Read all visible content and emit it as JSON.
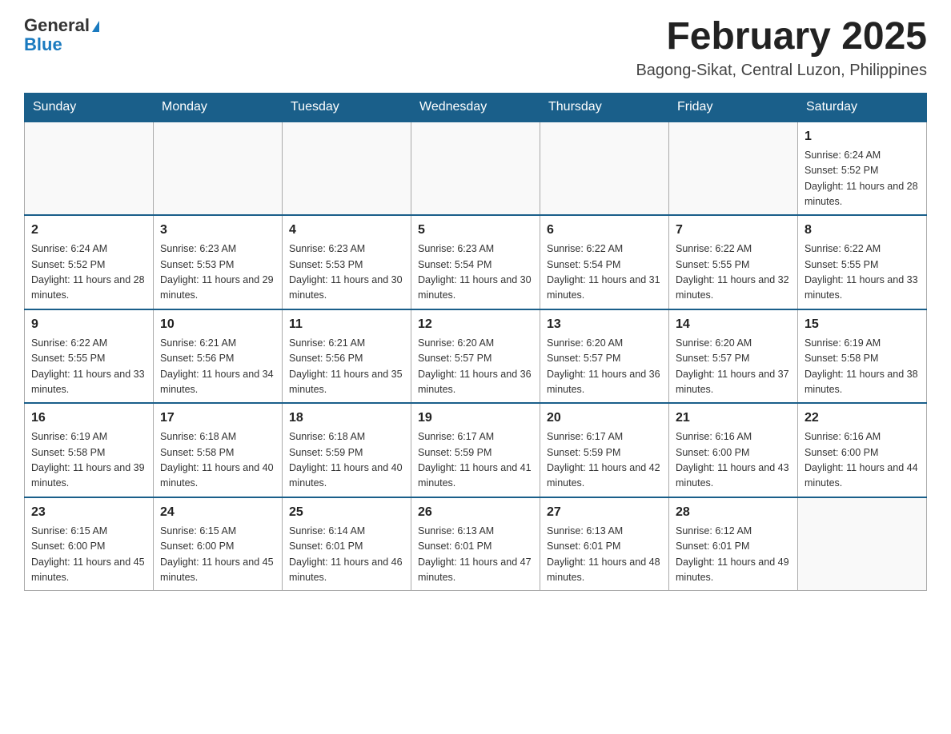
{
  "header": {
    "logo_general": "General",
    "logo_blue": "Blue",
    "title": "February 2025",
    "subtitle": "Bagong-Sikat, Central Luzon, Philippines"
  },
  "days_of_week": [
    "Sunday",
    "Monday",
    "Tuesday",
    "Wednesday",
    "Thursday",
    "Friday",
    "Saturday"
  ],
  "weeks": [
    [
      {
        "day": "",
        "sunrise": "",
        "sunset": "",
        "daylight": ""
      },
      {
        "day": "",
        "sunrise": "",
        "sunset": "",
        "daylight": ""
      },
      {
        "day": "",
        "sunrise": "",
        "sunset": "",
        "daylight": ""
      },
      {
        "day": "",
        "sunrise": "",
        "sunset": "",
        "daylight": ""
      },
      {
        "day": "",
        "sunrise": "",
        "sunset": "",
        "daylight": ""
      },
      {
        "day": "",
        "sunrise": "",
        "sunset": "",
        "daylight": ""
      },
      {
        "day": "1",
        "sunrise": "Sunrise: 6:24 AM",
        "sunset": "Sunset: 5:52 PM",
        "daylight": "Daylight: 11 hours and 28 minutes."
      }
    ],
    [
      {
        "day": "2",
        "sunrise": "Sunrise: 6:24 AM",
        "sunset": "Sunset: 5:52 PM",
        "daylight": "Daylight: 11 hours and 28 minutes."
      },
      {
        "day": "3",
        "sunrise": "Sunrise: 6:23 AM",
        "sunset": "Sunset: 5:53 PM",
        "daylight": "Daylight: 11 hours and 29 minutes."
      },
      {
        "day": "4",
        "sunrise": "Sunrise: 6:23 AM",
        "sunset": "Sunset: 5:53 PM",
        "daylight": "Daylight: 11 hours and 30 minutes."
      },
      {
        "day": "5",
        "sunrise": "Sunrise: 6:23 AM",
        "sunset": "Sunset: 5:54 PM",
        "daylight": "Daylight: 11 hours and 30 minutes."
      },
      {
        "day": "6",
        "sunrise": "Sunrise: 6:22 AM",
        "sunset": "Sunset: 5:54 PM",
        "daylight": "Daylight: 11 hours and 31 minutes."
      },
      {
        "day": "7",
        "sunrise": "Sunrise: 6:22 AM",
        "sunset": "Sunset: 5:55 PM",
        "daylight": "Daylight: 11 hours and 32 minutes."
      },
      {
        "day": "8",
        "sunrise": "Sunrise: 6:22 AM",
        "sunset": "Sunset: 5:55 PM",
        "daylight": "Daylight: 11 hours and 33 minutes."
      }
    ],
    [
      {
        "day": "9",
        "sunrise": "Sunrise: 6:22 AM",
        "sunset": "Sunset: 5:55 PM",
        "daylight": "Daylight: 11 hours and 33 minutes."
      },
      {
        "day": "10",
        "sunrise": "Sunrise: 6:21 AM",
        "sunset": "Sunset: 5:56 PM",
        "daylight": "Daylight: 11 hours and 34 minutes."
      },
      {
        "day": "11",
        "sunrise": "Sunrise: 6:21 AM",
        "sunset": "Sunset: 5:56 PM",
        "daylight": "Daylight: 11 hours and 35 minutes."
      },
      {
        "day": "12",
        "sunrise": "Sunrise: 6:20 AM",
        "sunset": "Sunset: 5:57 PM",
        "daylight": "Daylight: 11 hours and 36 minutes."
      },
      {
        "day": "13",
        "sunrise": "Sunrise: 6:20 AM",
        "sunset": "Sunset: 5:57 PM",
        "daylight": "Daylight: 11 hours and 36 minutes."
      },
      {
        "day": "14",
        "sunrise": "Sunrise: 6:20 AM",
        "sunset": "Sunset: 5:57 PM",
        "daylight": "Daylight: 11 hours and 37 minutes."
      },
      {
        "day": "15",
        "sunrise": "Sunrise: 6:19 AM",
        "sunset": "Sunset: 5:58 PM",
        "daylight": "Daylight: 11 hours and 38 minutes."
      }
    ],
    [
      {
        "day": "16",
        "sunrise": "Sunrise: 6:19 AM",
        "sunset": "Sunset: 5:58 PM",
        "daylight": "Daylight: 11 hours and 39 minutes."
      },
      {
        "day": "17",
        "sunrise": "Sunrise: 6:18 AM",
        "sunset": "Sunset: 5:58 PM",
        "daylight": "Daylight: 11 hours and 40 minutes."
      },
      {
        "day": "18",
        "sunrise": "Sunrise: 6:18 AM",
        "sunset": "Sunset: 5:59 PM",
        "daylight": "Daylight: 11 hours and 40 minutes."
      },
      {
        "day": "19",
        "sunrise": "Sunrise: 6:17 AM",
        "sunset": "Sunset: 5:59 PM",
        "daylight": "Daylight: 11 hours and 41 minutes."
      },
      {
        "day": "20",
        "sunrise": "Sunrise: 6:17 AM",
        "sunset": "Sunset: 5:59 PM",
        "daylight": "Daylight: 11 hours and 42 minutes."
      },
      {
        "day": "21",
        "sunrise": "Sunrise: 6:16 AM",
        "sunset": "Sunset: 6:00 PM",
        "daylight": "Daylight: 11 hours and 43 minutes."
      },
      {
        "day": "22",
        "sunrise": "Sunrise: 6:16 AM",
        "sunset": "Sunset: 6:00 PM",
        "daylight": "Daylight: 11 hours and 44 minutes."
      }
    ],
    [
      {
        "day": "23",
        "sunrise": "Sunrise: 6:15 AM",
        "sunset": "Sunset: 6:00 PM",
        "daylight": "Daylight: 11 hours and 45 minutes."
      },
      {
        "day": "24",
        "sunrise": "Sunrise: 6:15 AM",
        "sunset": "Sunset: 6:00 PM",
        "daylight": "Daylight: 11 hours and 45 minutes."
      },
      {
        "day": "25",
        "sunrise": "Sunrise: 6:14 AM",
        "sunset": "Sunset: 6:01 PM",
        "daylight": "Daylight: 11 hours and 46 minutes."
      },
      {
        "day": "26",
        "sunrise": "Sunrise: 6:13 AM",
        "sunset": "Sunset: 6:01 PM",
        "daylight": "Daylight: 11 hours and 47 minutes."
      },
      {
        "day": "27",
        "sunrise": "Sunrise: 6:13 AM",
        "sunset": "Sunset: 6:01 PM",
        "daylight": "Daylight: 11 hours and 48 minutes."
      },
      {
        "day": "28",
        "sunrise": "Sunrise: 6:12 AM",
        "sunset": "Sunset: 6:01 PM",
        "daylight": "Daylight: 11 hours and 49 minutes."
      },
      {
        "day": "",
        "sunrise": "",
        "sunset": "",
        "daylight": ""
      }
    ]
  ]
}
